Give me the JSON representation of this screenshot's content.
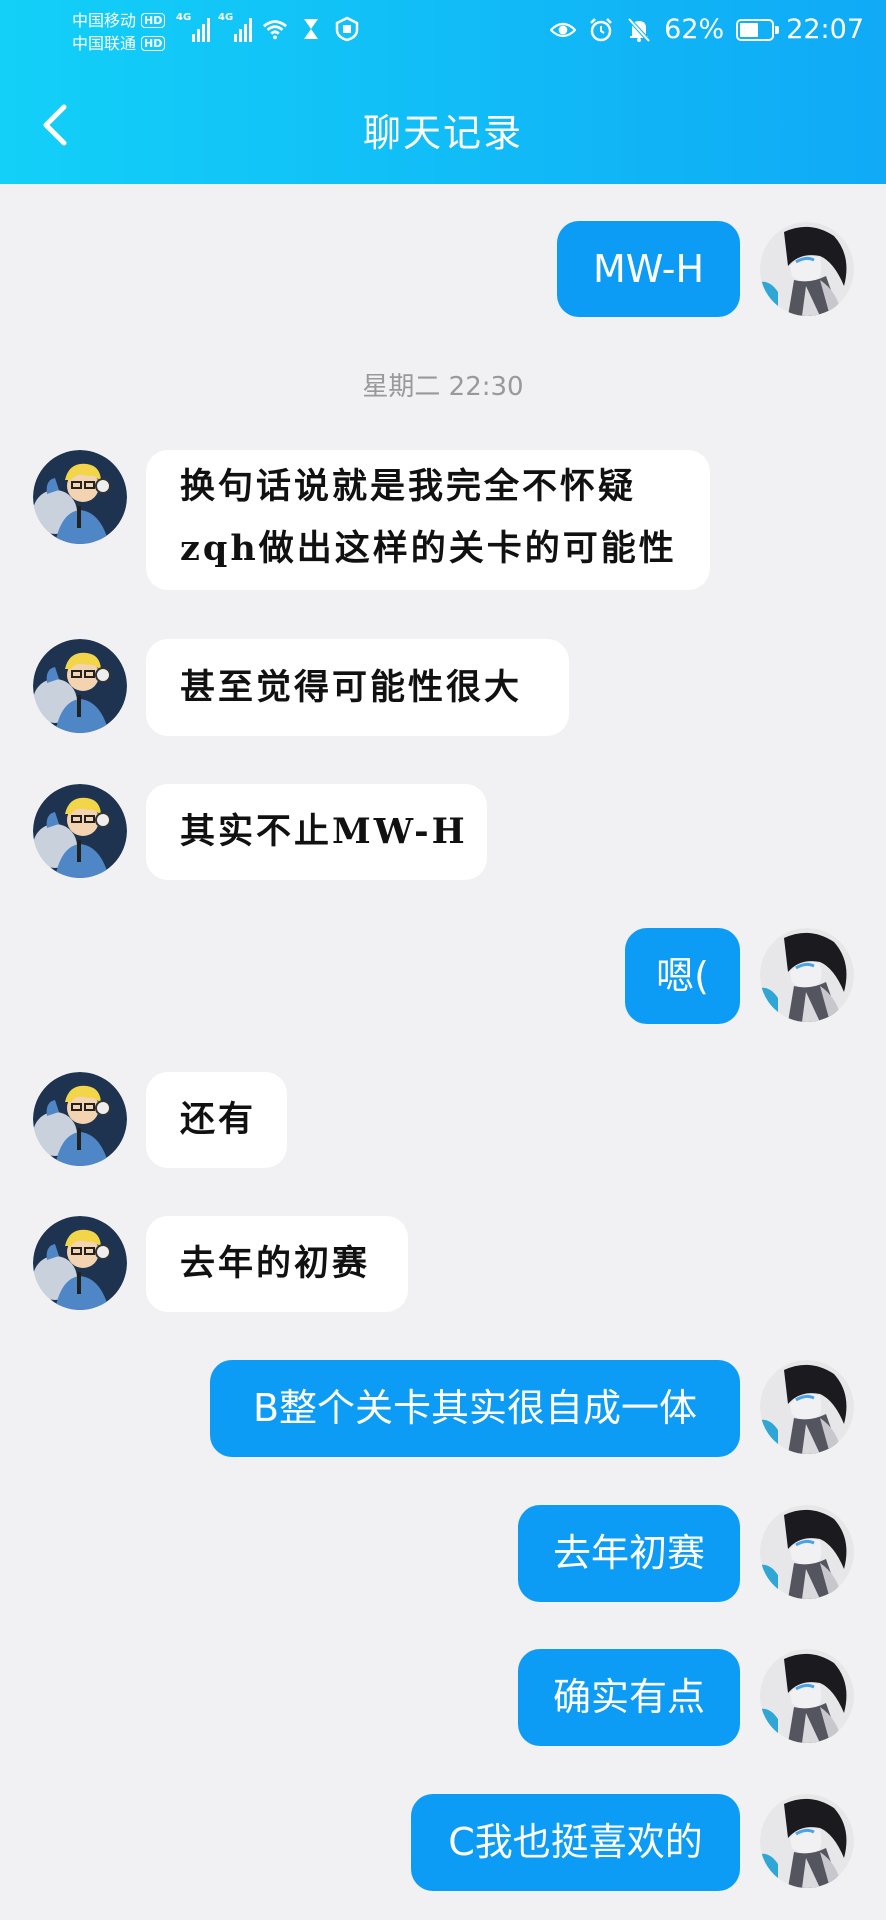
{
  "status_bar": {
    "carrier1": "中国移动",
    "carrier2": "中国联通",
    "hd": "HD",
    "network": "4G",
    "battery_percent": "62%",
    "battery_level": 0.62,
    "time": "22:07"
  },
  "header": {
    "title": "聊天记录",
    "back_icon": "chevron-left-icon"
  },
  "chat": {
    "timestamp": "星期二 22:30",
    "messages": [
      {
        "side": "out",
        "text": "MW-H"
      },
      {
        "side": "in",
        "text": "换句话说就是我完全不怀疑"
      },
      {
        "side": "in",
        "text": "zqh做出这样的关卡的可能性"
      },
      {
        "side": "in",
        "text": "甚至觉得可能性很大"
      },
      {
        "side": "in",
        "text": "其实不止MW-H"
      },
      {
        "side": "out",
        "text": "嗯("
      },
      {
        "side": "in",
        "text": "还有"
      },
      {
        "side": "in",
        "text": "去年的初赛"
      },
      {
        "side": "out",
        "text": "B整个关卡其实很自成一体"
      },
      {
        "side": "out",
        "text": "去年初赛"
      },
      {
        "side": "out",
        "text": "确实有点"
      },
      {
        "side": "out",
        "text": "C我也挺喜欢的"
      }
    ]
  },
  "colors": {
    "header_gradient_start": "#12d0f8",
    "header_gradient_end": "#10aaf6",
    "bubble_out": "#0c9bf5",
    "bubble_in": "#ffffff",
    "background": "#f1f1f3"
  }
}
